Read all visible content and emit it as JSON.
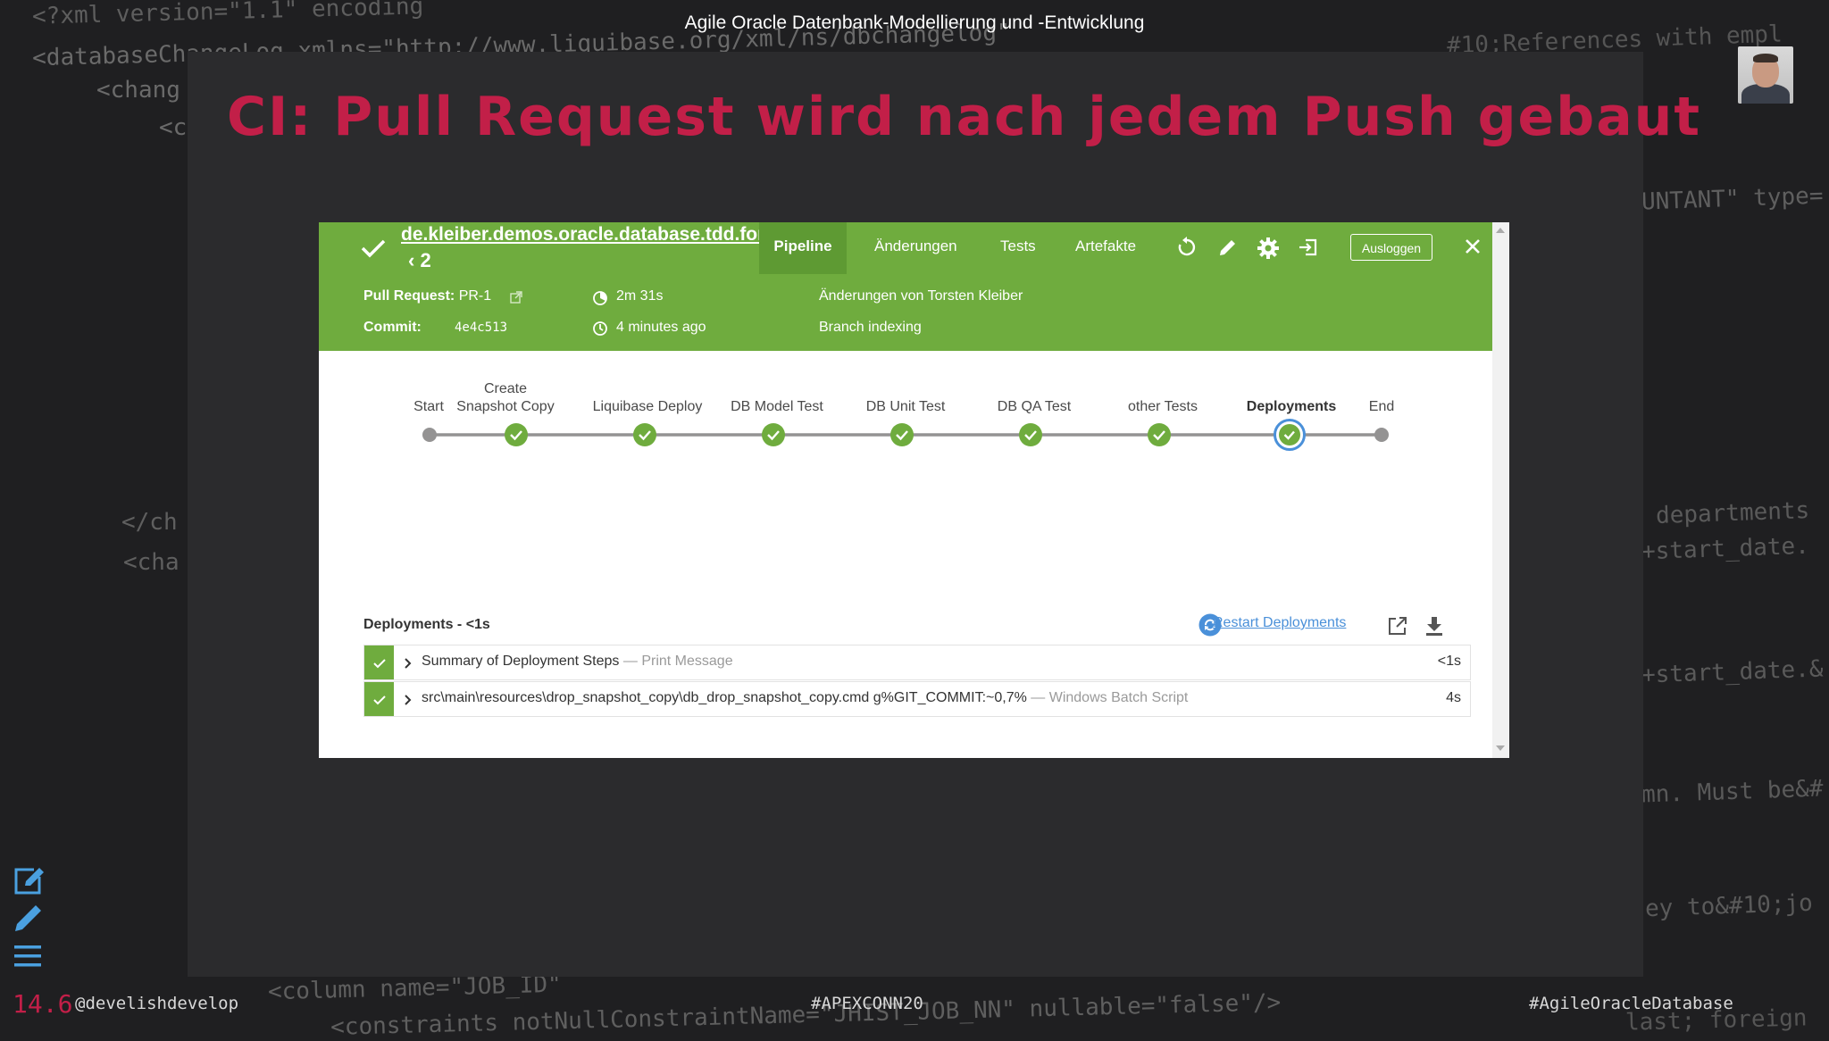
{
  "slide": {
    "title": "Agile Oracle Datenbank-Modellierung und -Entwicklung",
    "heading": "CI: Pull Request wird nach jedem Push gebaut",
    "slide_number": "14.6",
    "handle": "@develishdevelop",
    "hashtag_center": "#APEXCONN20",
    "hashtag_right": "#AgileOracleDatabase"
  },
  "background_code": [
    {
      "text": "<?xml version=\"1.1\" encoding",
      "color": "#6b6b6b"
    },
    {
      "text": "<databaseChangeLog xmlns=\"http://www.liquibase.org/xml/ns/dbchangelog\"",
      "color": "#6b6b6b"
    },
    {
      "text": "<chang",
      "color": "#6b6b6b"
    },
    {
      "text": "<c",
      "color": "#6b6b6b"
    },
    {
      "text": "</ch",
      "color": "#6b6b6b"
    },
    {
      "text": "<cha",
      "color": "#6b6b6b"
    },
    {
      "text": "#10;References with empl",
      "color": "#6b6b6b"
    },
    {
      "text": "UNTANT\" type=",
      "color": "#6b6b6b"
    },
    {
      "text": "departments",
      "color": "#6b6b6b"
    },
    {
      "text": "+start_date.",
      "color": "#6b6b6b"
    },
    {
      "text": "+start_date.&",
      "color": "#6b6b6b"
    },
    {
      "text": "mn. Must be&#",
      "color": "#6b6b6b"
    },
    {
      "text": "ey to&#10;jo",
      "color": "#6b6b6b"
    },
    {
      "text": "<column name=\"JOB_ID\"",
      "color": "#6b6b6b"
    },
    {
      "text": "<constraints notNullConstraintName=\"JHIST_JOB_NN\" nullable=\"false\"/>",
      "color": "#6b6b6b"
    },
    {
      "text": "last; foreign",
      "color": "#6b6b6b"
    }
  ],
  "jenkins": {
    "repo": "de.kleiber.demos.oracle.database.tdd.fork",
    "pr_number": "2",
    "tabs": [
      {
        "label": "Pipeline",
        "active": true
      },
      {
        "label": "Änderungen",
        "active": false
      },
      {
        "label": "Tests",
        "active": false
      },
      {
        "label": "Artefakte",
        "active": false
      }
    ],
    "logout_label": "Ausloggen",
    "pull_request_label": "Pull Request:",
    "pull_request_value": "PR-1",
    "commit_label": "Commit:",
    "commit_value": "4e4c513",
    "duration": "2m 31s",
    "time_ago": "4 minutes ago",
    "changes_by": "Änderungen von Torsten Kleiber",
    "cause": "Branch indexing",
    "accent_color": "#6fac3e",
    "stages": [
      {
        "label": "Start",
        "status": "node"
      },
      {
        "label": "Create Snapshot Copy",
        "status": "success"
      },
      {
        "label": "Liquibase Deploy",
        "status": "success"
      },
      {
        "label": "DB Model Test",
        "status": "success"
      },
      {
        "label": "DB Unit Test",
        "status": "success"
      },
      {
        "label": "DB QA Test",
        "status": "success"
      },
      {
        "label": "other Tests",
        "status": "success"
      },
      {
        "label": "Deployments",
        "status": "success-selected"
      },
      {
        "label": "End",
        "status": "node"
      }
    ],
    "steps_title": "Deployments - <1s",
    "restart_label": "Restart Deployments",
    "steps": [
      {
        "text": "Summary of Deployment Steps",
        "sub": "— Print Message",
        "duration": "<1s"
      },
      {
        "text": "src\\main\\resources\\drop_snapshot_copy\\db_drop_snapshot_copy.cmd g%GIT_COMMIT:~0,7%",
        "sub": "— Windows Batch Script",
        "duration": "4s"
      }
    ]
  }
}
